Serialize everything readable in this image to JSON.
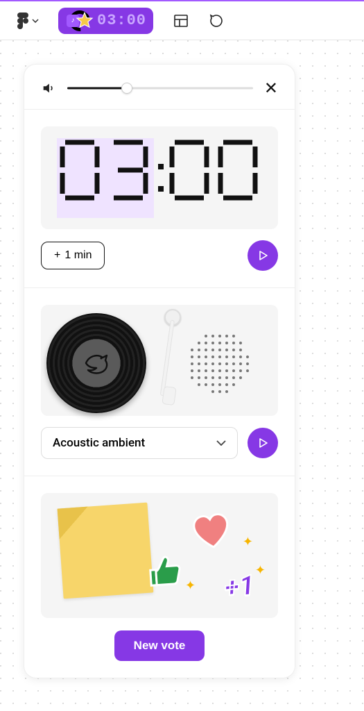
{
  "topbar": {
    "pill_time": "03:00"
  },
  "timer": {
    "minutes": "03",
    "seconds": "00",
    "add_label": "1 min"
  },
  "music": {
    "selected": "Acoustic ambient"
  },
  "vote": {
    "plus_label": "+1",
    "button_label": "New vote"
  }
}
